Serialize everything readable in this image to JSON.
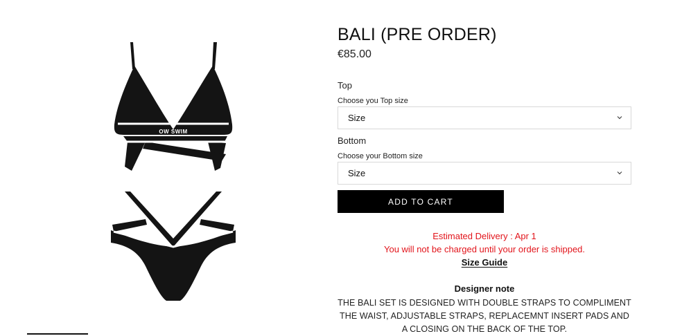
{
  "product": {
    "title": "BALI (PRE ORDER)",
    "price": "€85.00",
    "image_logo_text": "OW SWIM"
  },
  "options": {
    "top": {
      "label": "Top",
      "hint": "Choose you Top size",
      "selected": "Size"
    },
    "bottom": {
      "label": "Bottom",
      "hint": "Choose your Bottom size",
      "selected": "Size"
    }
  },
  "cart": {
    "add_label": "ADD TO CART"
  },
  "notices": {
    "delivery": "Estimated Delivery : Apr 1",
    "charge": "You will not be charged until your order is shipped.",
    "size_guide": "Size Guide"
  },
  "designer_note": {
    "heading": "Designer note",
    "body": "THE BALI SET IS DESIGNED WITH DOUBLE STRAPS TO COMPLIMENT THE WAIST, ADJUSTABLE STRAPS, REPLACEMNT INSERT PADS AND A CLOSING ON THE BACK OF THE TOP."
  },
  "colors": {
    "accent_red": "#e2141b",
    "button_bg": "#000000",
    "border": "#d8d8d8"
  },
  "icons": {
    "select_arrow": "chevron-down-icon"
  }
}
